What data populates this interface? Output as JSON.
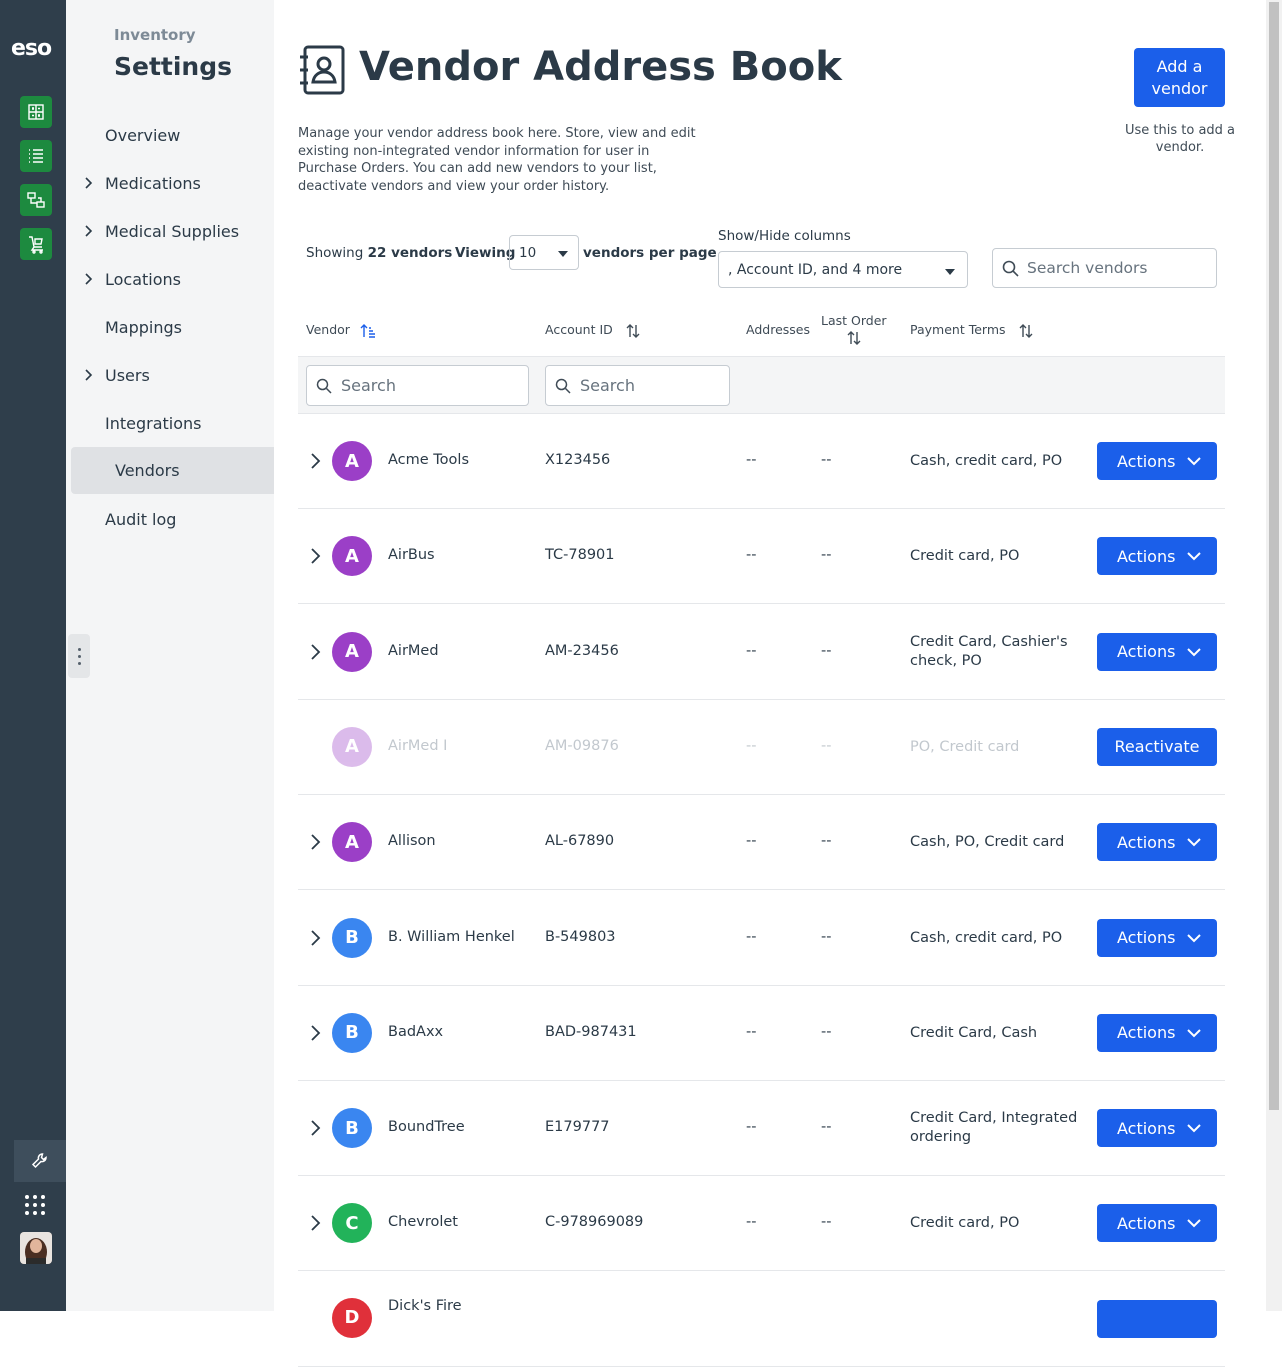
{
  "rail": {
    "logo": "eso",
    "buttons": [
      "inventory-icon",
      "list-icon",
      "transfer-icon",
      "cart-icon"
    ],
    "tools_icon": "wrench-icon",
    "apps_icon": "grid-icon",
    "avatar": "user-avatar"
  },
  "nav": {
    "sup_title": "Inventory",
    "title": "Settings",
    "items": [
      {
        "label": "Overview",
        "has_chevron": false
      },
      {
        "label": "Medications",
        "has_chevron": true
      },
      {
        "label": "Medical Supplies",
        "has_chevron": true
      },
      {
        "label": "Locations",
        "has_chevron": true
      },
      {
        "label": "Mappings",
        "has_chevron": false
      },
      {
        "label": "Users",
        "has_chevron": true
      },
      {
        "label": "Integrations",
        "has_chevron": false
      },
      {
        "label": "Vendors",
        "has_chevron": false,
        "active": true
      },
      {
        "label": "Audit log",
        "has_chevron": false
      }
    ]
  },
  "header": {
    "title": "Vendor Address Book",
    "description": "Manage your vendor address book here. Store, view and edit existing non-integrated vendor information for user in Purchase Orders. You can add new vendors to your list, deactivate vendors and view your order history.",
    "add_button": "Add a vendor",
    "add_hint": "Use this to add a vendor."
  },
  "toolbar": {
    "showing_prefix": "Showing",
    "showing_count": "22 vendors",
    "viewing_label": "Viewing",
    "per_page_value": "10",
    "per_page_suffix": "vendors per page",
    "columns_label": "Show/Hide columns",
    "columns_value": ", Account ID, and 4 more",
    "search_placeholder": "Search vendors"
  },
  "table": {
    "headers": {
      "vendor": "Vendor",
      "account_id": "Account ID",
      "addresses": "Addresses",
      "last_order": "Last Order",
      "payment_terms": "Payment Terms"
    },
    "filter_placeholder": "Search",
    "rows": [
      {
        "initial": "A",
        "color": "#9b3fc7",
        "name": "Acme Tools",
        "account": "X123456",
        "addresses": "--",
        "last_order": "--",
        "payment": "Cash, credit card, PO",
        "action": "Actions",
        "active": true
      },
      {
        "initial": "A",
        "color": "#9b3fc7",
        "name": "AirBus",
        "account": "TC-78901",
        "addresses": "--",
        "last_order": "--",
        "payment": "Credit card, PO",
        "action": "Actions",
        "active": true
      },
      {
        "initial": "A",
        "color": "#9b3fc7",
        "name": "AirMed",
        "account": "AM-23456",
        "addresses": "--",
        "last_order": "--",
        "payment": "Credit Card, Cashier's check, PO",
        "action": "Actions",
        "active": true
      },
      {
        "initial": "A",
        "color": "#9b3fc7",
        "name": "AirMed I",
        "account": "AM-09876",
        "addresses": "--",
        "last_order": "--",
        "payment": "PO, Credit card",
        "action": "Reactivate",
        "active": false
      },
      {
        "initial": "A",
        "color": "#9b3fc7",
        "name": "Allison",
        "account": "AL-67890",
        "addresses": "--",
        "last_order": "--",
        "payment": "Cash, PO, Credit card",
        "action": "Actions",
        "active": true
      },
      {
        "initial": "B",
        "color": "#3a86f0",
        "name": "B. William Henkel",
        "account": "B-549803",
        "addresses": "--",
        "last_order": "--",
        "payment": "Cash, credit card, PO",
        "action": "Actions",
        "active": true
      },
      {
        "initial": "B",
        "color": "#3a86f0",
        "name": "BadAxx",
        "account": "BAD-987431",
        "addresses": "--",
        "last_order": "--",
        "payment": "Credit Card, Cash",
        "action": "Actions",
        "active": true
      },
      {
        "initial": "B",
        "color": "#3a86f0",
        "name": "BoundTree",
        "account": "E179777",
        "addresses": "--",
        "last_order": "--",
        "payment": "Credit Card, Integrated ordering",
        "action": "Actions",
        "active": true
      },
      {
        "initial": "C",
        "color": "#22b35a",
        "name": "Chevrolet",
        "account": "C-978969089",
        "addresses": "--",
        "last_order": "--",
        "payment": "Credit card, PO",
        "action": "Actions",
        "active": true
      },
      {
        "initial": "D",
        "color": "#e0303a",
        "name": "Dick's Fire",
        "account": "",
        "addresses": "",
        "last_order": "",
        "payment": "",
        "action": "",
        "active": true
      }
    ]
  }
}
